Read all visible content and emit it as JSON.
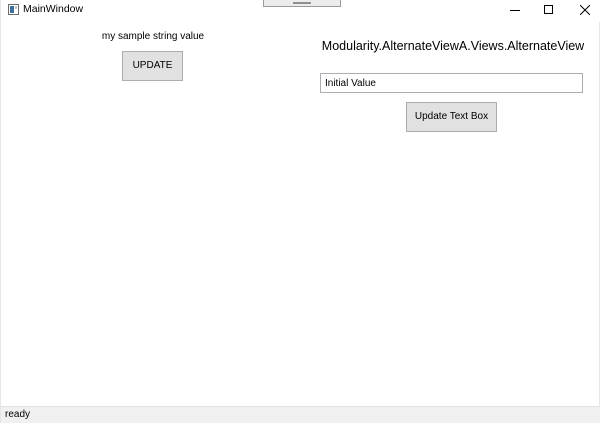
{
  "window": {
    "title": "MainWindow",
    "icon": "app-window-icon",
    "caption_buttons": [
      "minimize-icon",
      "maximize-icon",
      "close-icon"
    ]
  },
  "left_region": {
    "sample_text": "my sample string value",
    "update_label": "UPDATE"
  },
  "right_region": {
    "view_title": "Modularity.AlternateViewA.Views.AlternateView",
    "text_box_value": "Initial Value",
    "update_text_box_label": "Update Text Box"
  },
  "status_bar": {
    "text": "ready"
  },
  "colors": {
    "button_face": "#e1e1e1",
    "button_border": "#adadad",
    "textbox_border": "#abadb3",
    "statusbar_bg": "#f0f0f0"
  }
}
